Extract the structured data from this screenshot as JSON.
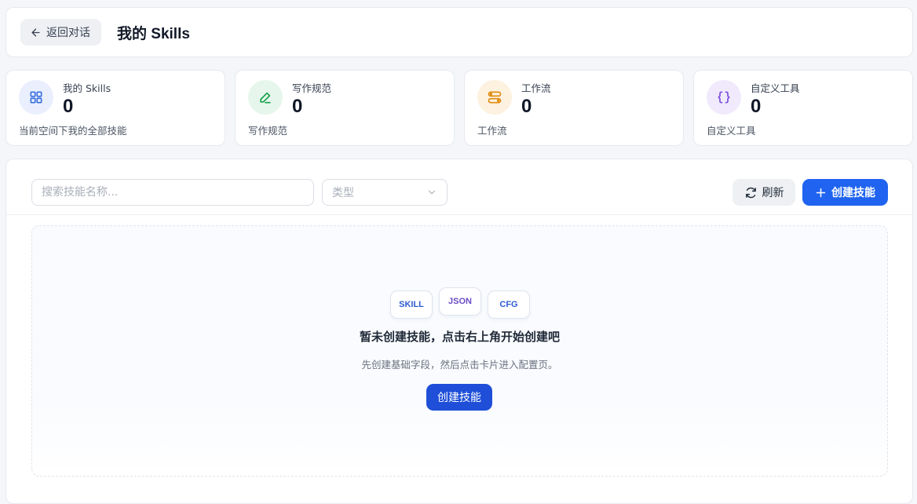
{
  "header": {
    "back_label": "返回对话",
    "title": "我的 Skills"
  },
  "stats": [
    {
      "label": "我的 Skills",
      "value": "0",
      "desc": "当前空间下我的全部技能",
      "icon": "grid-icon",
      "icon_color": "#3b6fe0",
      "icon_bg": "#e9effd"
    },
    {
      "label": "写作规范",
      "value": "0",
      "desc": "写作规范",
      "icon": "pencil-icon",
      "icon_color": "#16a34a",
      "icon_bg": "#e6f6ec"
    },
    {
      "label": "工作流",
      "value": "0",
      "desc": "工作流",
      "icon": "workflow-icon",
      "icon_color": "#e08a0b",
      "icon_bg": "#fdf1df"
    },
    {
      "label": "自定义工具",
      "value": "0",
      "desc": "自定义工具",
      "icon": "braces-icon",
      "icon_color": "#7c4ddb",
      "icon_bg": "#f0eafc"
    }
  ],
  "toolbar": {
    "search_placeholder": "搜索技能名称...",
    "type_placeholder": "类型",
    "refresh_label": "刷新",
    "create_label": "创建技能"
  },
  "empty_state": {
    "chips": [
      {
        "text": "SKILL",
        "color": "#2f5bd3"
      },
      {
        "text": "JSON",
        "color": "#6a4bc4"
      },
      {
        "text": "CFG",
        "color": "#2f5bd3"
      }
    ],
    "title": "暂未创建技能，点击右上角开始创建吧",
    "description": "先创建基础字段，然后点击卡片进入配置页。",
    "button_label": "创建技能"
  },
  "colors": {
    "primary": "#1f63f0",
    "background": "#f4f6fa"
  }
}
